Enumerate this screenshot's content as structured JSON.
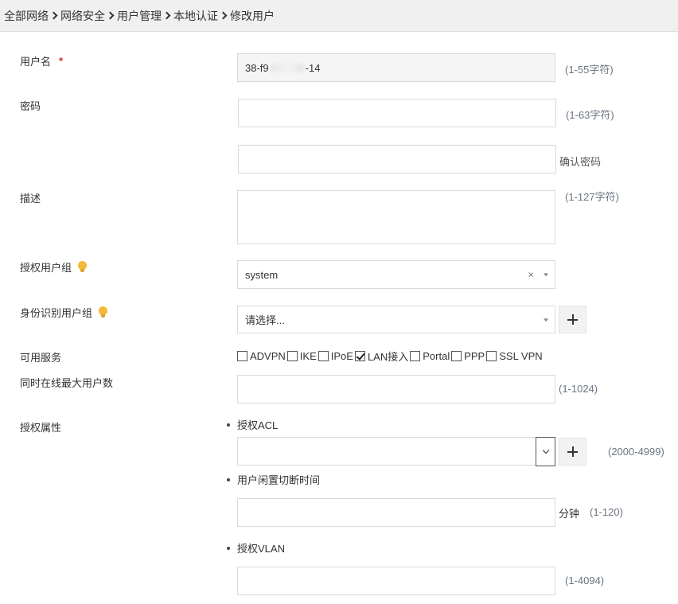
{
  "breadcrumb": [
    "全部网络",
    "网络安全",
    "用户管理",
    "本地认证",
    "修改用户"
  ],
  "form": {
    "username": {
      "label": "用户名",
      "required_mark": "*",
      "value_prefix": "38-f9",
      "value_suffix": "-14",
      "hint": "(1-55字符)"
    },
    "password": {
      "label": "密码",
      "hint": "(1-63字符)",
      "confirm_hint": "确认密码"
    },
    "description": {
      "label": "描述",
      "hint": "(1-127字符)"
    },
    "auth_group": {
      "label": "授权用户组",
      "value": "system",
      "clear_symbol": "×"
    },
    "identity_group": {
      "label": "身份识别用户组",
      "placeholder": "请选择..."
    },
    "services": {
      "label": "可用服务",
      "items": [
        {
          "label": "ADVPN",
          "checked": false
        },
        {
          "label": "IKE",
          "checked": false
        },
        {
          "label": "IPoE",
          "checked": false
        },
        {
          "label": "LAN接入",
          "checked": true
        },
        {
          "label": "Portal",
          "checked": false
        },
        {
          "label": "PPP",
          "checked": false
        },
        {
          "label": "SSL VPN",
          "checked": false
        }
      ]
    },
    "max_online": {
      "label": "同时在线最大用户数",
      "hint": "(1-1024)"
    },
    "auth_attrs": {
      "label": "授权属性",
      "acl": {
        "label": "授权ACL",
        "hint": "(2000-4999)"
      },
      "idle": {
        "label": "用户闲置切断时间",
        "unit": "分钟",
        "hint": "(1-120)"
      },
      "vlan": {
        "label": "授权VLAN",
        "hint": "(1-4094)"
      }
    }
  },
  "icons": {
    "tip": "lightbulb-icon",
    "add": "plus-icon",
    "dropdown": "chevron-down-icon"
  },
  "colors": {
    "required": "#d9272e",
    "tip_bulb": "#f5b93a",
    "hint_text": "#6b7580"
  }
}
